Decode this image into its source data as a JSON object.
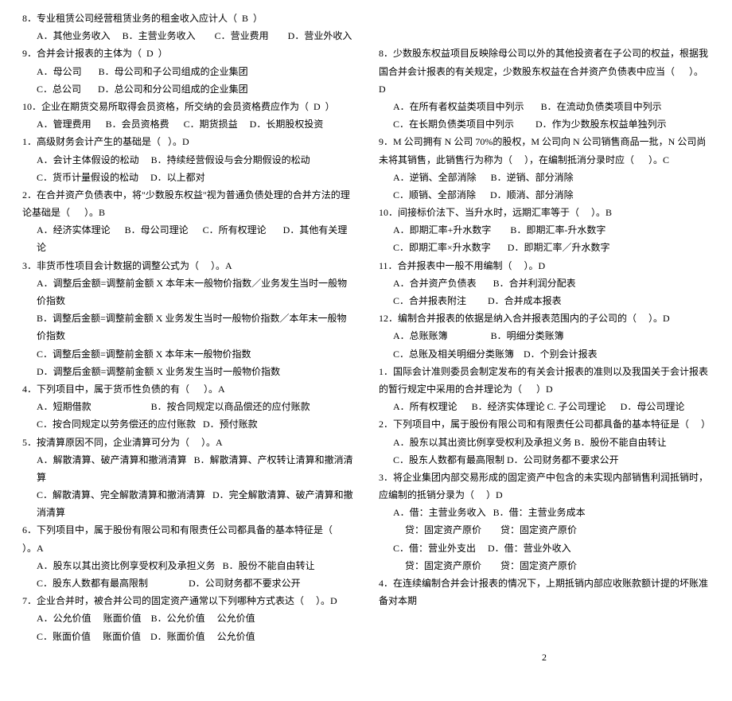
{
  "pageNumber": "2",
  "left": [
    {
      "t": "8．专业租赁公司经营租赁业务的租金收入应计人（  B  ）",
      "cls": ""
    },
    {
      "t": "A．其他业务收入     B．主营业务收入        C．营业费用        D．营业外收入",
      "cls": "indent1"
    },
    {
      "t": "9．合并会计报表的主体为（  D  ）",
      "cls": ""
    },
    {
      "t": "A．母公司       B．母公司和子公司组成的企业集团",
      "cls": "indent1"
    },
    {
      "t": "C．总公司       D．总公司和分公司组成的企业集团",
      "cls": "indent1"
    },
    {
      "t": "10．企业在期货交易所取得会员资格，所交纳的会员资格费应作为（  D  ）",
      "cls": ""
    },
    {
      "t": "A．管理费用      B．会员资格费      C．期货损益     D．长期股权投资",
      "cls": "indent1"
    },
    {
      "t": "1．高级财务会计产生的基础是（   ）。D",
      "cls": ""
    },
    {
      "t": "A．会计主体假设的松动     B．持续经营假设与会分期假设的松动",
      "cls": "indent1"
    },
    {
      "t": "C．货币计量假设的松动     D．以上都对",
      "cls": "indent1"
    },
    {
      "t": "2．在合并资产负债表中，将\"少数股东权益\"视为普通负债处理的合并方法的理论基础是（      ）。B",
      "cls": ""
    },
    {
      "t": "A．经济实体理论      B．母公司理论      C．所有权理论       D．其他有关理论",
      "cls": "indent1"
    },
    {
      "t": "3．非货币性项目会计数据的调整公式为（     ）。A",
      "cls": ""
    },
    {
      "t": "A．调整后金额=调整前金额 X 本年末一般物价指数／业务发生当时一般物价指数",
      "cls": "indent1"
    },
    {
      "t": "B．调整后金额=调整前金额 X 业务发生当时一般物价指数／本年末一般物价指数",
      "cls": "indent1"
    },
    {
      "t": "C．调整后金额=调整前金额 X 本年末一般物价指数",
      "cls": "indent1"
    },
    {
      "t": "D．调整后金额=调整前金额 X 业务发生当时一般物价指数",
      "cls": "indent1"
    },
    {
      "t": "4．下列项目中，属于货币性负债的有（      ）。A",
      "cls": ""
    },
    {
      "t": "A．短期借款                         B．按合同规定以商品偿还的应付账款",
      "cls": "indent1"
    },
    {
      "t": "C．按合同规定以劳务偿还的应付账款   D．预付账款",
      "cls": "indent1"
    },
    {
      "t": "5．按清算原因不同，企业清算可分为（     ）。A",
      "cls": ""
    },
    {
      "t": "A．解散清算、破产清算和撤消清算   B．解散清算、产权转让清算和撤消清算",
      "cls": "indent1"
    },
    {
      "t": "C．解散清算、完全解散清算和撤消清算   D．完全解散清算、破产清算和撤消清算",
      "cls": "indent1"
    },
    {
      "t": "6．下列项目中，属于股份有限公司和有限责任公司都具备的基本特征是（     ）。A",
      "cls": ""
    },
    {
      "t": "A．股东以其出资比例享受权利及承担义务   B．股份不能自由转让",
      "cls": "indent1"
    },
    {
      "t": "C．股东人数都有最高限制                 D．公司财务都不要求公开",
      "cls": "indent1"
    },
    {
      "t": "7．企业合并时，被合并公司的固定资产通常以下列哪种方式表达（     ）。D",
      "cls": ""
    },
    {
      "t": "A．公允价值     账面价值    B．公允价值     公允价值",
      "cls": "indent1"
    },
    {
      "t": "C．账面价值     账面价值    D．账面价值     公允价值",
      "cls": "indent1"
    }
  ],
  "right": [
    {
      "t": "8．少数股东权益项目反映除母公司以外的其他投资者在子公司的权益，根据我国合并会计报表的有关规定，少数股东权益在合并资产负债表中应当（      ）。D",
      "cls": ""
    },
    {
      "t": "A．在所有者权益类项目中列示       B．在流动负债类项目中列示",
      "cls": "indent1"
    },
    {
      "t": "C．在长期负债类项目中列示         D．作为少数股东权益单独列示",
      "cls": "indent1"
    },
    {
      "t": "9．M 公司拥有 N 公司 70%的股权，M 公司向 N 公司销售商品一批，N 公司尚未将其销售，此销售行为称为（     ），在编制抵消分录时应（      ）。C",
      "cls": ""
    },
    {
      "t": "A．逆销、全部消除      B．逆销、部分消除",
      "cls": "indent1"
    },
    {
      "t": "C．顺销、全部消除      D．顺消、部分消除",
      "cls": "indent1"
    },
    {
      "t": "10．间接标价法下、当升水时，远期汇率等于（     ）。B",
      "cls": ""
    },
    {
      "t": "A．即期汇率+升水数字        B．即期汇率-升水数字",
      "cls": "indent1"
    },
    {
      "t": "C．即期汇率×升水数字       D．即期汇率／升水数字",
      "cls": "indent1"
    },
    {
      "t": "11．合并报表中一般不用编制（     ）。D",
      "cls": ""
    },
    {
      "t": "A．合并资产负债表       B．合并利润分配表",
      "cls": "indent1"
    },
    {
      "t": "C．合并报表附注         D．合并成本报表",
      "cls": "indent1"
    },
    {
      "t": "12．编制合并报表的依据是纳入合并报表范围内的子公司的（     ）。D",
      "cls": ""
    },
    {
      "t": "A．总账账簿                  B．明细分类账簿",
      "cls": "indent1"
    },
    {
      "t": "C．总账及相关明细分类账簿    D．个别会计报表",
      "cls": "indent1"
    },
    {
      "t": "1．国际会计准则委员会制定发布的有关会计报表的准则以及我国关于会计报表的暂行规定中采用的合并理论为（      ）D",
      "cls": ""
    },
    {
      "t": "A．所有权理论      B．经济实体理论 C. 子公司理论      D．母公司理论",
      "cls": "indent1"
    },
    {
      "t": "2．下列项目中，属于股份有限公司和有限责任公司都具备的基本特征是（     ）",
      "cls": ""
    },
    {
      "t": "A．股东以其出资比例享受权利及承担义务 B．股份不能自由转让",
      "cls": "indent1"
    },
    {
      "t": "C．股东人数都有最高限制 D．公司财务都不要求公开",
      "cls": "indent1"
    },
    {
      "t": "3．将企业集团内部交易形成的固定资产中包含的未实现内部销售利润抵销时，应编制的抵销分录为（     ）D",
      "cls": ""
    },
    {
      "t": "A．借：主营业务收入   B．借：主营业务成本",
      "cls": "indent1"
    },
    {
      "t": "     贷：固定资产原价        贷：固定资产原价",
      "cls": "indent1"
    },
    {
      "t": "C．借：营业外支出     D．借：营业外收入",
      "cls": "indent1"
    },
    {
      "t": "     贷：固定资产原价        贷：固定资产原价",
      "cls": "indent1"
    },
    {
      "t": "4．在连续编制合并会计报表的情况下，上期抵销内部应收账款额计提的坏账准备对本期",
      "cls": ""
    }
  ]
}
